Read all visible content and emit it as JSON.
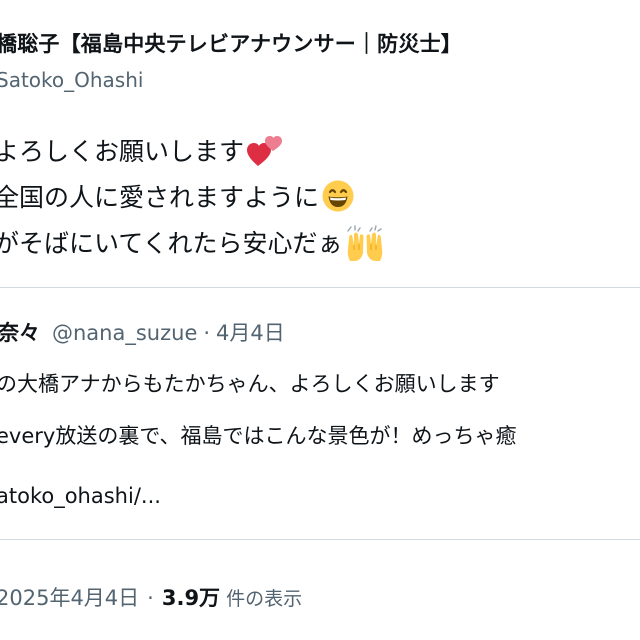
{
  "author": {
    "name": "橋聡子【福島中央テレビアナウンサー｜防災士】",
    "handle": "Satoko_Ohashi"
  },
  "tweet": {
    "line1": "よろしくお願いします",
    "line1_emoji": "two-hearts-icon",
    "line2": "全国の人に愛されますように",
    "line2_emoji": "grinning-face-icon",
    "line3": "がそばにいてくれたら安心だぁ",
    "line3_emoji": "raising-hands-icon"
  },
  "quoted_tweet": {
    "name": "奈々",
    "handle": "@nana_suzue",
    "separator": "·",
    "date": "4月4日",
    "line1": "の大橋アナからもたかちゃん、よろしくお願いします",
    "line2": "every放送の裏で、福島ではこんな景色が！めっちゃ癒",
    "line3": "atoko_ohashi/..."
  },
  "meta": {
    "timestamp": "2025年4月4日",
    "separator": "·",
    "views_count": "3.9万",
    "views_label": "件の表示"
  },
  "colors": {
    "text_primary": "#0f1419",
    "text_secondary": "#536471",
    "divider": "#cfd9de"
  }
}
